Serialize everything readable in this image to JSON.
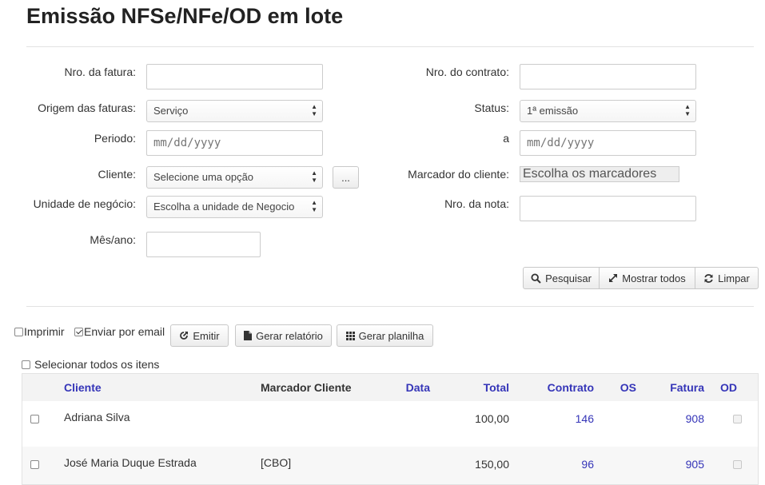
{
  "page": {
    "title": "Emissão NFSe/NFe/OD em lote"
  },
  "filters": {
    "nro_fatura_label": "Nro. da fatura:",
    "nro_contrato_label": "Nro. do contrato:",
    "origem_label": "Origem das faturas:",
    "origem_value": "Serviço",
    "status_label": "Status:",
    "status_value": "1ª emissão",
    "periodo_label": "Periodo:",
    "periodo_placeholder": "mm/dd/yyyy",
    "periodo_to_label": "a",
    "periodo_to_placeholder": "mm/dd/yyyy",
    "cliente_label": "Cliente:",
    "cliente_value": "Selecione uma opção",
    "cliente_more_label": "...",
    "marcador_label": "Marcador do cliente:",
    "marcador_placeholder": "Escolha os marcadores",
    "unidade_label": "Unidade de negócio:",
    "unidade_value": "Escolha a unidade de Negocio",
    "nro_nota_label": "Nro. da nota:",
    "mes_ano_label": "Mês/ano:"
  },
  "search_actions": {
    "pesquisar": "Pesquisar",
    "mostrar_todos": "Mostrar todos",
    "limpar": "Limpar"
  },
  "bulk_actions": {
    "imprimir": "Imprimir",
    "imprimir_checked": false,
    "enviar_email": "Enviar por email",
    "enviar_email_checked": true,
    "emitir": "Emitir",
    "gerar_relatorio": "Gerar relatório",
    "gerar_planilha": "Gerar planilha",
    "selecionar_todos": "Selecionar todos os itens"
  },
  "table": {
    "headers": {
      "cliente": "Cliente",
      "marcador": "Marcador Cliente",
      "data": "Data",
      "total": "Total",
      "contrato": "Contrato",
      "os": "OS",
      "fatura": "Fatura",
      "od": "OD"
    },
    "rows": [
      {
        "cliente": "Adriana Silva",
        "marcador": "",
        "data": "",
        "total": "100,00",
        "contrato": "146",
        "os": "",
        "fatura": "908"
      },
      {
        "cliente": "José Maria Duque Estrada",
        "marcador": "[CBO]",
        "data": "",
        "total": "150,00",
        "contrato": "96",
        "os": "",
        "fatura": "905"
      }
    ]
  }
}
